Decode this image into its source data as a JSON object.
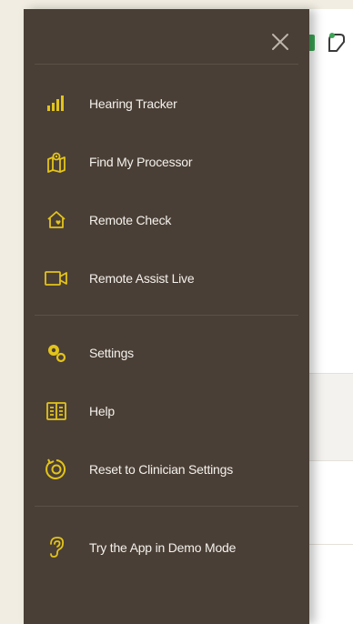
{
  "drawer": {
    "close_label": "×",
    "primary_items": [
      {
        "label": "Hearing Tracker",
        "icon": "signal-bars-icon"
      },
      {
        "label": "Find My Processor",
        "icon": "map-pin-icon"
      },
      {
        "label": "Remote Check",
        "icon": "home-heart-icon"
      },
      {
        "label": "Remote Assist Live",
        "icon": "video-camera-icon"
      }
    ],
    "secondary_items": [
      {
        "label": "Settings",
        "icon": "gears-icon"
      },
      {
        "label": "Help",
        "icon": "book-icon"
      },
      {
        "label": "Reset to Clinician Settings",
        "icon": "reset-target-icon"
      }
    ],
    "demo_item": {
      "label": "Try the App in Demo Mode",
      "icon": "ear-icon"
    }
  },
  "colors": {
    "drawer_bg": "#4a3f36",
    "accent": "#e3c41a",
    "text": "#f4f1ec",
    "status_green": "#3aa655"
  }
}
